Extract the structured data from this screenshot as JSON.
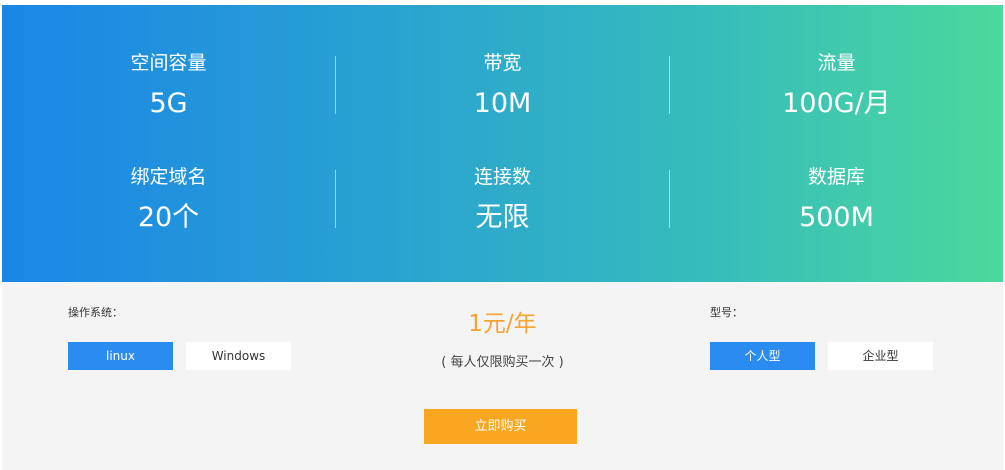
{
  "stats": [
    {
      "label": "空间容量",
      "value": "5G"
    },
    {
      "label": "带宽",
      "value": "10M"
    },
    {
      "label": "流量",
      "value": "100G/月"
    },
    {
      "label": "绑定域名",
      "value": "20个"
    },
    {
      "label": "连接数",
      "value": "无限"
    },
    {
      "label": "数据库",
      "value": "500M"
    }
  ],
  "os": {
    "label": "操作系统：",
    "options": [
      "linux",
      "Windows"
    ],
    "selected": "linux"
  },
  "model": {
    "label": "型号：",
    "options": [
      "个人型",
      "企业型"
    ],
    "selected": "个人型"
  },
  "price": {
    "amount": "1元/年",
    "note": "( 每人仅限购买一次 )"
  },
  "buy_label": "立即购买",
  "colors": {
    "gradient_start": "#1a86e6",
    "gradient_end": "#4cd89c",
    "accent_blue": "#2a8cf0",
    "price_orange": "#f7a333",
    "buy_button": "#f9a620"
  }
}
